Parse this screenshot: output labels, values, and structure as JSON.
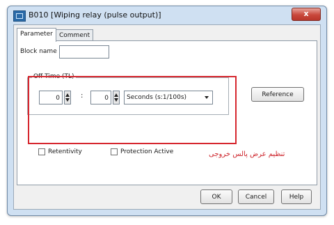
{
  "window": {
    "title": "B010 [Wiping relay (pulse output)]",
    "close_label": "x"
  },
  "tabs": [
    {
      "label": "Parameter",
      "active": true
    },
    {
      "label": "Comment",
      "active": false
    }
  ],
  "parameter": {
    "block_name_label": "Block name",
    "block_name_value": "",
    "off_time": {
      "group_label": "Off Time (TL)",
      "value1": "0",
      "separator": ":",
      "value2": "0",
      "unit": "Seconds (s:1/100s)"
    },
    "reference_label": "Reference",
    "retentivity_label": "Retentivity",
    "retentivity_checked": false,
    "protection_label": "Protection Active",
    "protection_checked": false
  },
  "annotation": {
    "text": "تنظیم عرض پالس خروجی",
    "color": "#d6262e"
  },
  "buttons": {
    "ok": "OK",
    "cancel": "Cancel",
    "help": "Help"
  }
}
